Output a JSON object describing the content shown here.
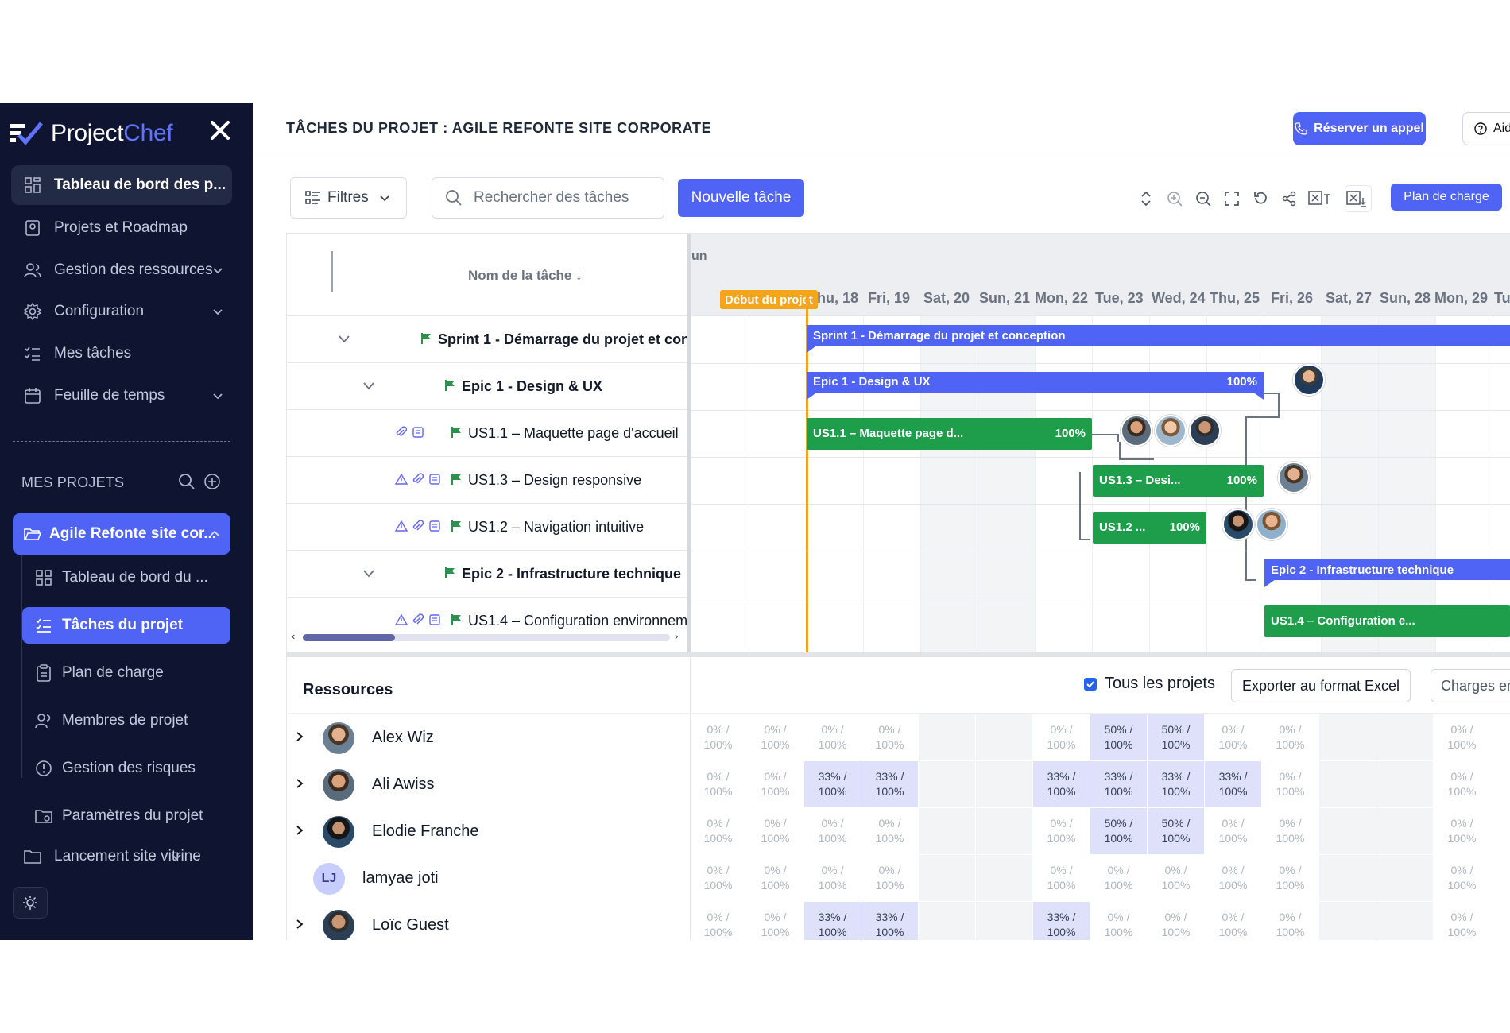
{
  "sidebar": {
    "logo_prefix": "Project",
    "logo_accent": "Chef",
    "nav": [
      {
        "label": "Tableau de bord des p...",
        "icon": "dashboard-icon"
      },
      {
        "label": "Projets et Roadmap",
        "icon": "roadmap-icon"
      },
      {
        "label": "Gestion des ressources",
        "icon": "users-icon"
      },
      {
        "label": "Configuration",
        "icon": "gear-icon"
      },
      {
        "label": "Mes tâches",
        "icon": "checklist-icon"
      },
      {
        "label": "Feuille de temps",
        "icon": "calendar-icon"
      }
    ],
    "section_label": "MES PROJETS",
    "active_project": "Agile Refonte site cor...",
    "sub_items": [
      {
        "label": "Tableau de bord du ..."
      },
      {
        "label": "Tâches du projet"
      },
      {
        "label": "Plan de charge"
      },
      {
        "label": "Membres de projet"
      },
      {
        "label": "Gestion des risques"
      },
      {
        "label": "Paramètres du projet"
      }
    ],
    "other_project": "Lancement site vitrine"
  },
  "header": {
    "title": "TÂCHES DU PROJET : AGILE REFONTE SITE CORPORATE",
    "call_button": "Réserver un appel",
    "help_button": "Aide"
  },
  "toolbar": {
    "filters_label": "Filtres",
    "search_placeholder": "Rechercher des tâches",
    "new_task_label": "Nouvelle tâche",
    "plan_label": "Plan de charge"
  },
  "gantt": {
    "column_title": "Nom de la tâche ↓",
    "month_label": "un",
    "project_start_label": "Début du projet",
    "days": [
      "hu, 18",
      "Fri, 19",
      "Sat, 20",
      "Sun, 21",
      "Mon, 22",
      "Tue, 23",
      "Wed, 24",
      "Thu, 25",
      "Fri, 26",
      "Sat, 27",
      "Sun, 28",
      "Mon, 29",
      "Tu"
    ],
    "tasks": [
      {
        "name": "Sprint 1 - Démarrage du projet et conception",
        "bar": "Sprint 1 - Démarrage du projet et conception",
        "pct": ""
      },
      {
        "name": "Epic 1 - Design & UX",
        "bar": "Epic 1 - Design & UX",
        "pct": "100%"
      },
      {
        "name": "US1.1 – Maquette page d'accueil",
        "bar": "US1.1 – Maquette page d...",
        "pct": "100%"
      },
      {
        "name": "US1.3 – Design responsive",
        "bar": "US1.3 – Desi...",
        "pct": "100%"
      },
      {
        "name": "US1.2 – Navigation intuitive",
        "bar": "US1.2 ...",
        "pct": "100%"
      },
      {
        "name": "Epic 2 - Infrastructure technique",
        "bar": "Epic 2 - Infrastructure technique",
        "pct": ""
      },
      {
        "name": "US1.4 – Configuration environnem",
        "bar": "US1.4 – Configuration e...",
        "pct": ""
      }
    ]
  },
  "resources": {
    "title": "Ressources",
    "all_projects_label": "Tous les projets",
    "export_label": "Exporter au format Excel",
    "charges_label": "Charges en",
    "people": [
      {
        "name": "Alex Wiz",
        "initials": ""
      },
      {
        "name": "Ali Awiss",
        "initials": ""
      },
      {
        "name": "Elodie Franche",
        "initials": ""
      },
      {
        "name": "lamyae joti",
        "initials": "LJ"
      },
      {
        "name": "Loïc Guest",
        "initials": ""
      }
    ],
    "loads": [
      [
        "0% /",
        "0% /",
        "0% /",
        "0% /",
        "",
        "",
        "0% /",
        "50% /",
        "50% /",
        "0% /",
        "0% /",
        "",
        "",
        "0% /"
      ],
      [
        "0% /",
        "0% /",
        "33% /",
        "33% /",
        "",
        "",
        "33% /",
        "33% /",
        "33% /",
        "33% /",
        "0% /",
        "",
        "",
        "0% /"
      ],
      [
        "0% /",
        "0% /",
        "0% /",
        "0% /",
        "",
        "",
        "0% /",
        "50% /",
        "50% /",
        "0% /",
        "0% /",
        "",
        "",
        "0% /"
      ],
      [
        "0% /",
        "0% /",
        "0% /",
        "0% /",
        "",
        "",
        "0% /",
        "0% /",
        "0% /",
        "0% /",
        "0% /",
        "",
        "",
        "0% /"
      ],
      [
        "0% /",
        "0% /",
        "33% /",
        "33% /",
        "",
        "",
        "33% /",
        "0% /",
        "0% /",
        "0% /",
        "0% /",
        "",
        "",
        "0% /"
      ]
    ],
    "capacity": "100%"
  }
}
